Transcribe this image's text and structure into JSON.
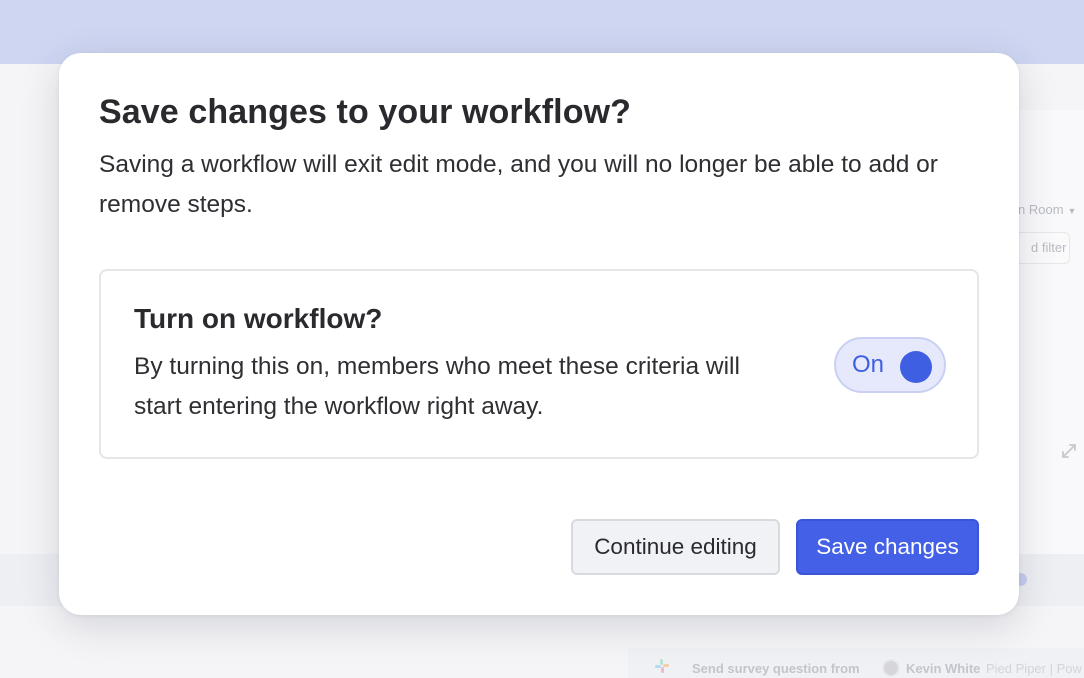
{
  "background": {
    "room_filter_label": "n Room",
    "add_filter_label": "d filter",
    "bottom_row": {
      "action_text": "Send survey question from",
      "person_name": "Kevin White",
      "org_text": "Pied Piper | Pow"
    }
  },
  "modal": {
    "title": "Save changes to your workflow?",
    "description": "Saving a workflow will exit edit mode, and you will no longer be able to add or remove steps.",
    "toggle_card": {
      "title": "Turn on workflow?",
      "description": "By turning this on, members who meet these criteria will start entering the workflow right away.",
      "toggle": {
        "label": "On",
        "state": "on"
      }
    },
    "buttons": {
      "continue_editing": "Continue editing",
      "save_changes": "Save changes"
    }
  },
  "colors": {
    "accent": "#4360e6",
    "toggle_bg": "#e5e9fb",
    "topbar": "#cfd6f2"
  }
}
